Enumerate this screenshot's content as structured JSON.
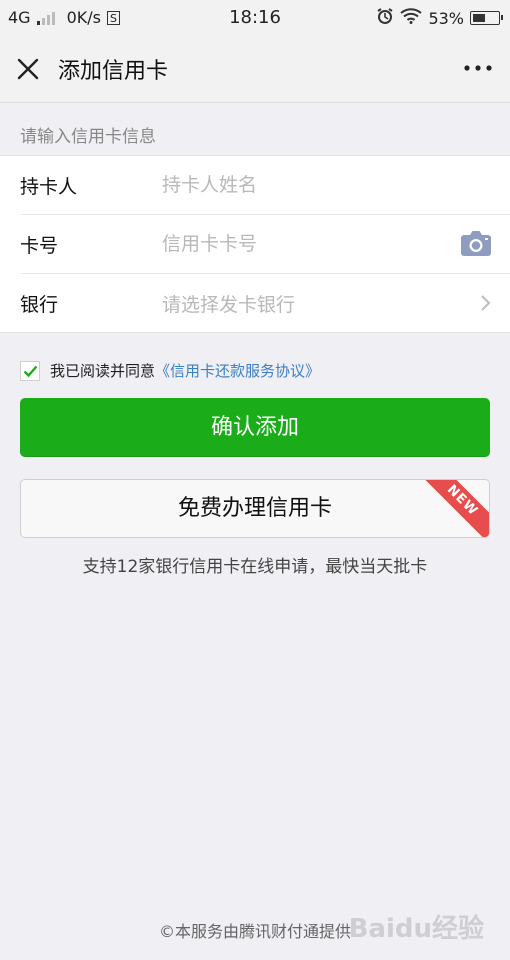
{
  "status_bar": {
    "network": "4G",
    "speed": "0K/s",
    "s_badge": "S",
    "time": "18:16",
    "battery": "53%",
    "battery_level": 0.53
  },
  "nav": {
    "title": "添加信用卡"
  },
  "section_label": "请输入信用卡信息",
  "form": {
    "holder_label": "持卡人",
    "holder_placeholder": "持卡人姓名",
    "number_label": "卡号",
    "number_placeholder": "信用卡卡号",
    "bank_label": "银行",
    "bank_placeholder": "请选择发卡银行"
  },
  "agreement": {
    "checked": true,
    "text": "我已阅读并同意",
    "link": "《信用卡还款服务协议》"
  },
  "confirm_button": "确认添加",
  "apply_button": "免费办理信用卡",
  "apply_badge": "NEW",
  "apply_note": "支持12家银行信用卡在线申请，最快当天批卡",
  "footer": "©本服务由腾讯财付通提供",
  "watermark": "Baidu经验",
  "colors": {
    "primary_green": "#1aad19",
    "link_blue": "#3b7fc4",
    "badge_red": "#e84d4d",
    "background": "#efeff4"
  }
}
